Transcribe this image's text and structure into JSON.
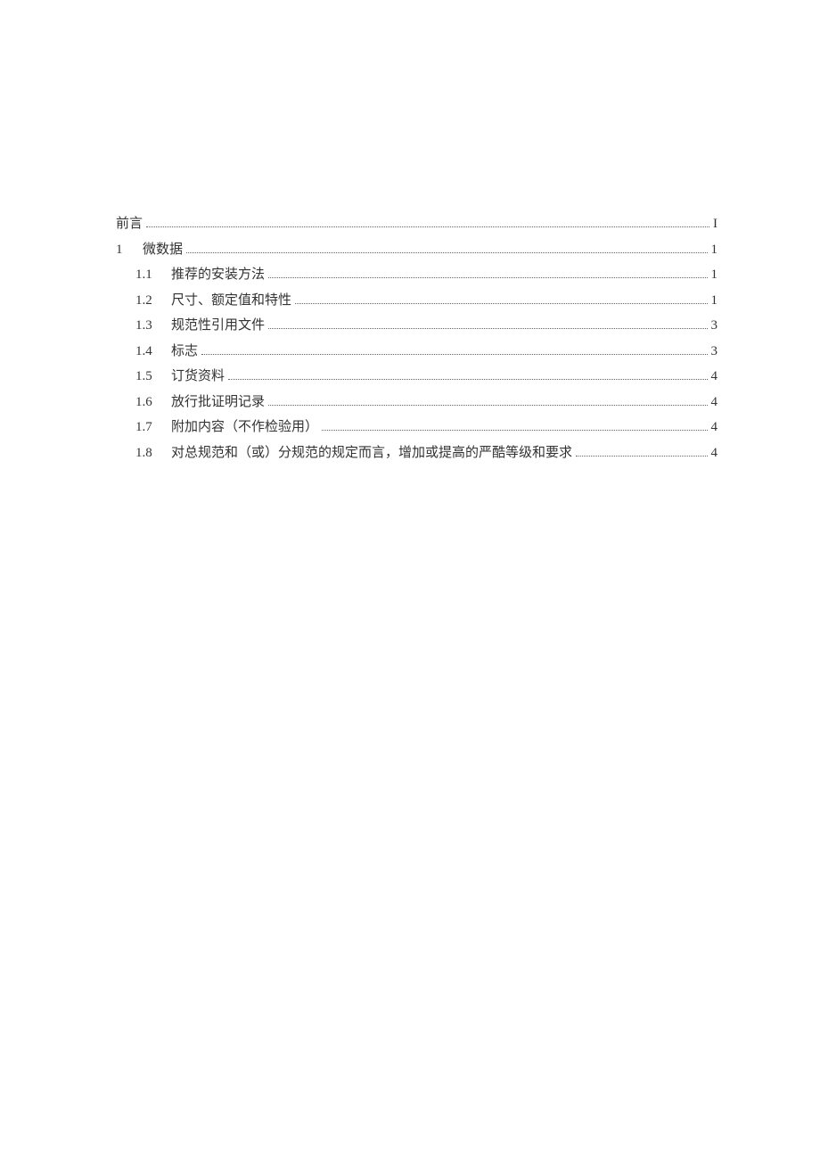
{
  "toc": [
    {
      "level": 0,
      "number": "",
      "title": "前言",
      "page": "I"
    },
    {
      "level": 1,
      "number": "1",
      "title": "微数据",
      "page": "1"
    },
    {
      "level": 2,
      "number": "1.1",
      "title": "推荐的安装方法",
      "page": "1"
    },
    {
      "level": 2,
      "number": "1.2",
      "title": "尺寸、额定值和特性",
      "page": "1"
    },
    {
      "level": 2,
      "number": "1.3",
      "title": "规范性引用文件",
      "page": "3"
    },
    {
      "level": 2,
      "number": "1.4",
      "title": "标志",
      "page": "3"
    },
    {
      "level": 2,
      "number": "1.5",
      "title": "订货资料",
      "page": "4"
    },
    {
      "level": 2,
      "number": "1.6",
      "title": "放行批证明记录",
      "page": "4"
    },
    {
      "level": 2,
      "number": "1.7",
      "title": "附加内容（不作检验用）",
      "page": "4"
    },
    {
      "level": 2,
      "number": "1.8",
      "title": "对总规范和（或）分规范的规定而言，增加或提高的严酷等级和要求",
      "page": "4"
    }
  ]
}
